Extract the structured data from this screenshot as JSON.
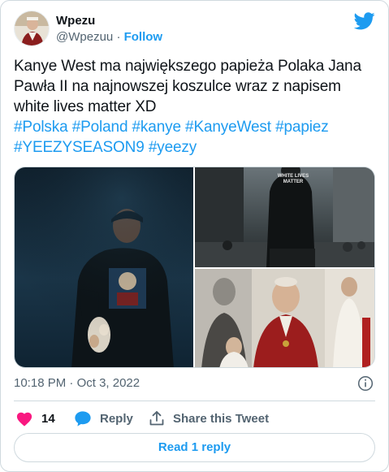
{
  "author": {
    "name": "Wpezu",
    "handle": "@Wpezuu",
    "separator": "·",
    "follow_label": "Follow"
  },
  "tweet": {
    "text": "Kanye West ma największego papieża Polaka Jana Pawła II na najnowszej koszulce wraz z napisem white lives matter XD",
    "hashtags": [
      "#Polska",
      "#Poland",
      "#kanye",
      "#KanyeWest",
      "#papiez",
      "#YEEZYSEASON9",
      "#yeezy"
    ],
    "images": [
      {
        "icon": "photo-kanye-hoodie"
      },
      {
        "icon": "photo-white-lives-matter-shirt"
      },
      {
        "icon": "photo-pope-john-paul-ii"
      }
    ],
    "shirt_text": "WHITE LIVES MATTER"
  },
  "meta": {
    "time": "10:18 PM",
    "separator": "·",
    "date": "Oct 3, 2022"
  },
  "actions": {
    "likes": "14",
    "reply_label": "Reply",
    "share_label": "Share this Tweet"
  },
  "read_replies_label": "Read 1 reply",
  "colors": {
    "accent": "#1d9bf0",
    "like": "#f91880",
    "text": "#0f1419",
    "muted": "#536471",
    "border": "#cfd9de"
  }
}
